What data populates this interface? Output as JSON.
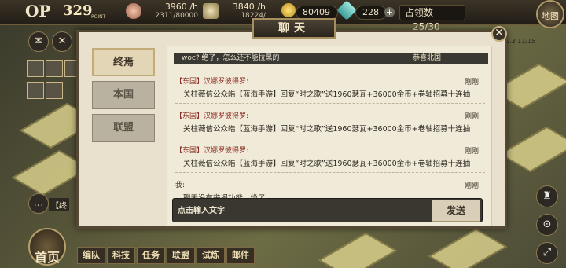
{
  "hud": {
    "op_label": "OP",
    "points": "329",
    "points_label": "POINT",
    "res1_main": "3960",
    "res1_unit": "/h",
    "res1_sub": "2311/80000",
    "res2_main": "3840",
    "res2_unit": "/h",
    "res2_sub": "18224/",
    "gold": "80409",
    "gems": "228",
    "occupy_label": "占领数",
    "occupy_value": "25/30",
    "map_label": "地图"
  },
  "dialog": {
    "title": "聊天",
    "close_glyph": "✕",
    "tabs": [
      {
        "label": "终焉",
        "active": true
      },
      {
        "label": "本国",
        "active": false
      },
      {
        "label": "联盟",
        "active": false
      }
    ],
    "top_message": {
      "text": "woc? 绝了，怎么还不能拉黑的",
      "tag": "恭喜北国"
    },
    "messages": [
      {
        "sender": "【东国】汉娜罗彼得罗:",
        "time": "刚刚",
        "body": "关柱薇信公众皓【蓝海手游】回复“时之歌”送1960瑟瓦+36000金币+卷轴招募十连抽"
      },
      {
        "sender": "【东国】汉娜罗彼得罗:",
        "time": "刚刚",
        "body": "关柱薇信公众皓【蓝海手游】回复“时之歌”送1960瑟瓦+36000金币+卷轴招募十连抽"
      },
      {
        "sender": "【东国】汉娜罗彼得罗:",
        "time": "刚刚",
        "body": "关柱薇信公众皓【蓝海手游】回复“时之歌”送1960瑟瓦+36000金币+卷轴招募十连抽"
      }
    ],
    "my_message": {
      "sender": "我:",
      "time": "刚刚",
      "body": "聊天没有举报功能，绝了"
    },
    "input_placeholder": "点击输入文字",
    "send_label": "发送"
  },
  "left": {
    "info_text": "【终"
  },
  "right": {
    "label": "v.3  11/15"
  },
  "nav": {
    "home": "首页",
    "items": [
      "编队",
      "科技",
      "任务",
      "联盟",
      "试炼",
      "邮件"
    ]
  },
  "colors": {
    "dialog_bg": "#e9e1cd",
    "dark_frame": "#544733",
    "sender_red": "#8b2d22",
    "gold_trim": "#a58f5f"
  }
}
